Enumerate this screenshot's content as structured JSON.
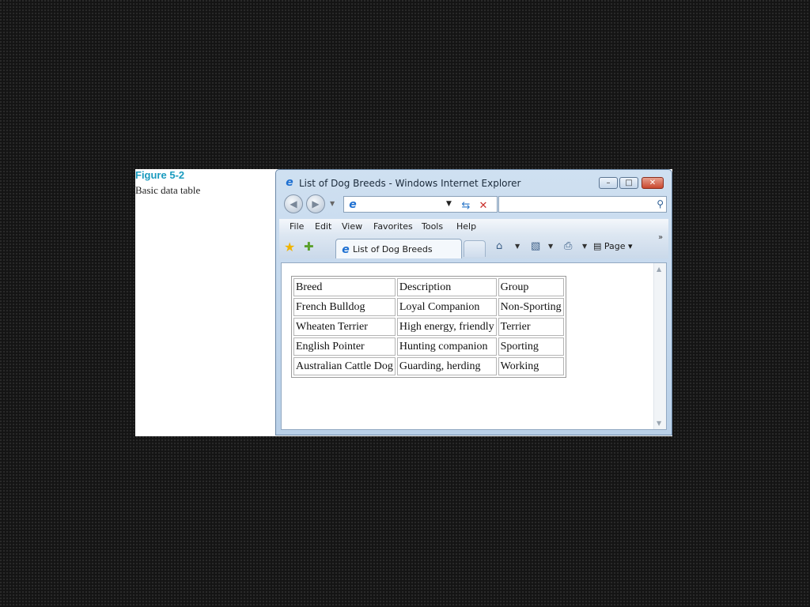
{
  "figure": {
    "number": "Figure 5-2",
    "caption": "Basic data table"
  },
  "window": {
    "title": "List of Dog Breeds - Windows Internet Explorer",
    "buttons": {
      "minimize": "–",
      "maximize": "□",
      "close": "✕"
    }
  },
  "nav": {
    "back_icon": "back-arrow-icon",
    "forward_icon": "forward-arrow-icon",
    "address_value": "",
    "search_placeholder": ""
  },
  "menu": [
    "File",
    "Edit",
    "View",
    "Favorites",
    "Tools",
    "Help"
  ],
  "tabs": [
    {
      "label": "List of Dog Breeds"
    }
  ],
  "toolbar": {
    "page_label": "Page",
    "overflow": "»"
  },
  "table": {
    "headers": [
      "Breed",
      "Description",
      "Group"
    ],
    "rows": [
      [
        "French Bulldog",
        "Loyal Companion",
        "Non-Sporting"
      ],
      [
        "Wheaten Terrier",
        "High energy, friendly",
        "Terrier"
      ],
      [
        "English Pointer",
        "Hunting companion",
        "Sporting"
      ],
      [
        "Australian Cattle Dog",
        "Guarding, herding",
        "Working"
      ]
    ]
  },
  "colors": {
    "figure_label": "#1a9bbf",
    "ie_logo": "#1d6fd1",
    "close_button": "#c9472e",
    "slide_background": "#141414"
  }
}
